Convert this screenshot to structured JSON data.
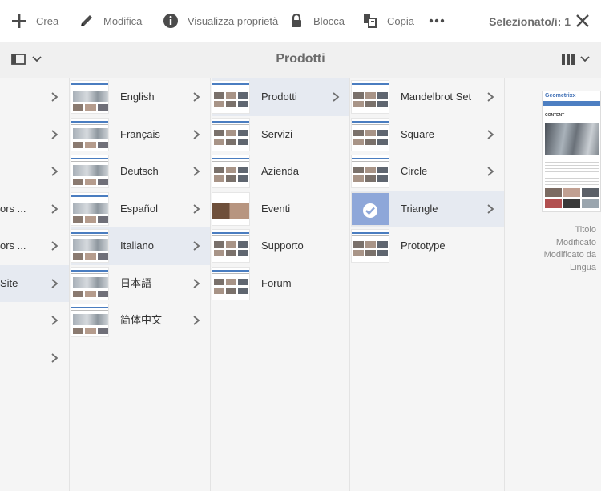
{
  "toolbar": {
    "create_label": "Crea",
    "edit_label": "Modifica",
    "properties_label": "Visualizza proprietà",
    "lock_label": "Blocca",
    "copy_label": "Copia",
    "selected_label": "Selezionato/i: 1"
  },
  "header": {
    "title": "Prodotti"
  },
  "column0": {
    "items": [
      {
        "label": ""
      },
      {
        "label": ""
      },
      {
        "label": ""
      },
      {
        "label": "ors ..."
      },
      {
        "label": "ors ..."
      },
      {
        "label": "Site"
      },
      {
        "label": ""
      },
      {
        "label": ""
      }
    ]
  },
  "column1": {
    "items": [
      {
        "label": "English"
      },
      {
        "label": "Français"
      },
      {
        "label": "Deutsch"
      },
      {
        "label": "Español"
      },
      {
        "label": "Italiano"
      },
      {
        "label": "日本語"
      },
      {
        "label": "简体中文"
      }
    ]
  },
  "column2": {
    "items": [
      {
        "label": "Prodotti"
      },
      {
        "label": "Servizi"
      },
      {
        "label": "Azienda"
      },
      {
        "label": "Eventi"
      },
      {
        "label": "Supporto"
      },
      {
        "label": "Forum"
      }
    ]
  },
  "column3": {
    "items": [
      {
        "label": "Mandelbrot Set"
      },
      {
        "label": "Square"
      },
      {
        "label": "Circle"
      },
      {
        "label": "Triangle"
      },
      {
        "label": "Prototype"
      }
    ]
  },
  "preview": {
    "brand": "Geometrixx",
    "content_heading": "CONTENT",
    "meta": [
      "Titolo",
      "Modificato",
      "Modificato da",
      "Lingua"
    ]
  },
  "colors": {
    "selected_row": "#e6eaf1",
    "checked_thumb": "#8ea7d9",
    "toolbar_text": "#707070"
  }
}
